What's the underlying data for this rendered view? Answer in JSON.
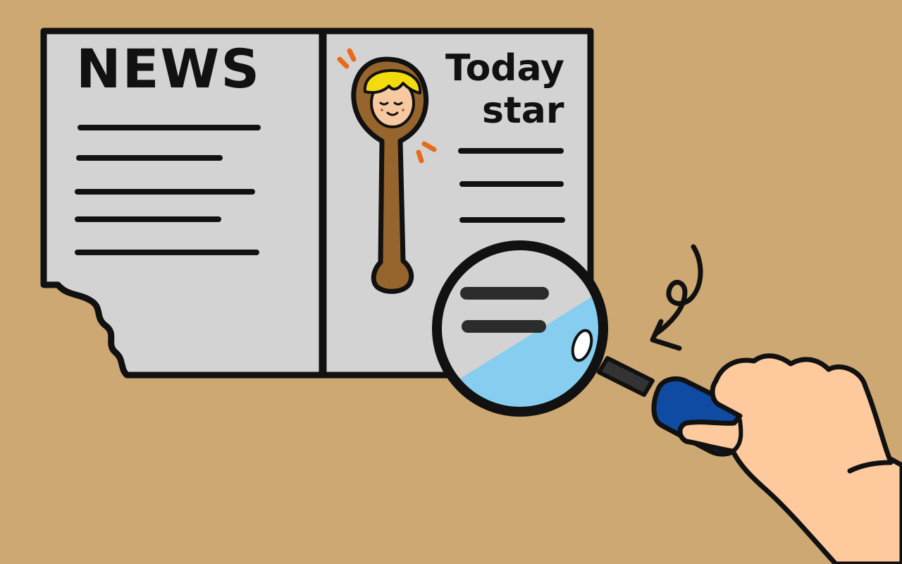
{
  "newspaper": {
    "left_heading": "NEWS",
    "right_heading_line1": "Today",
    "right_heading_line2": "star"
  },
  "colors": {
    "background": "#cda872",
    "paper": "#d3d3d3",
    "outline": "#111111",
    "spoon": "#96652e",
    "hair": "#f3dc0e",
    "skin": "#f7c9a1",
    "sparkle": "#e86a1a",
    "lens": "#86cdf0",
    "handle": "#0f4ba3"
  },
  "icons": {
    "spoon": "wooden-spoon-portrait-icon",
    "magnifier": "magnifying-glass-icon",
    "hand": "hand-icon",
    "arrow": "curly-arrow-icon"
  }
}
